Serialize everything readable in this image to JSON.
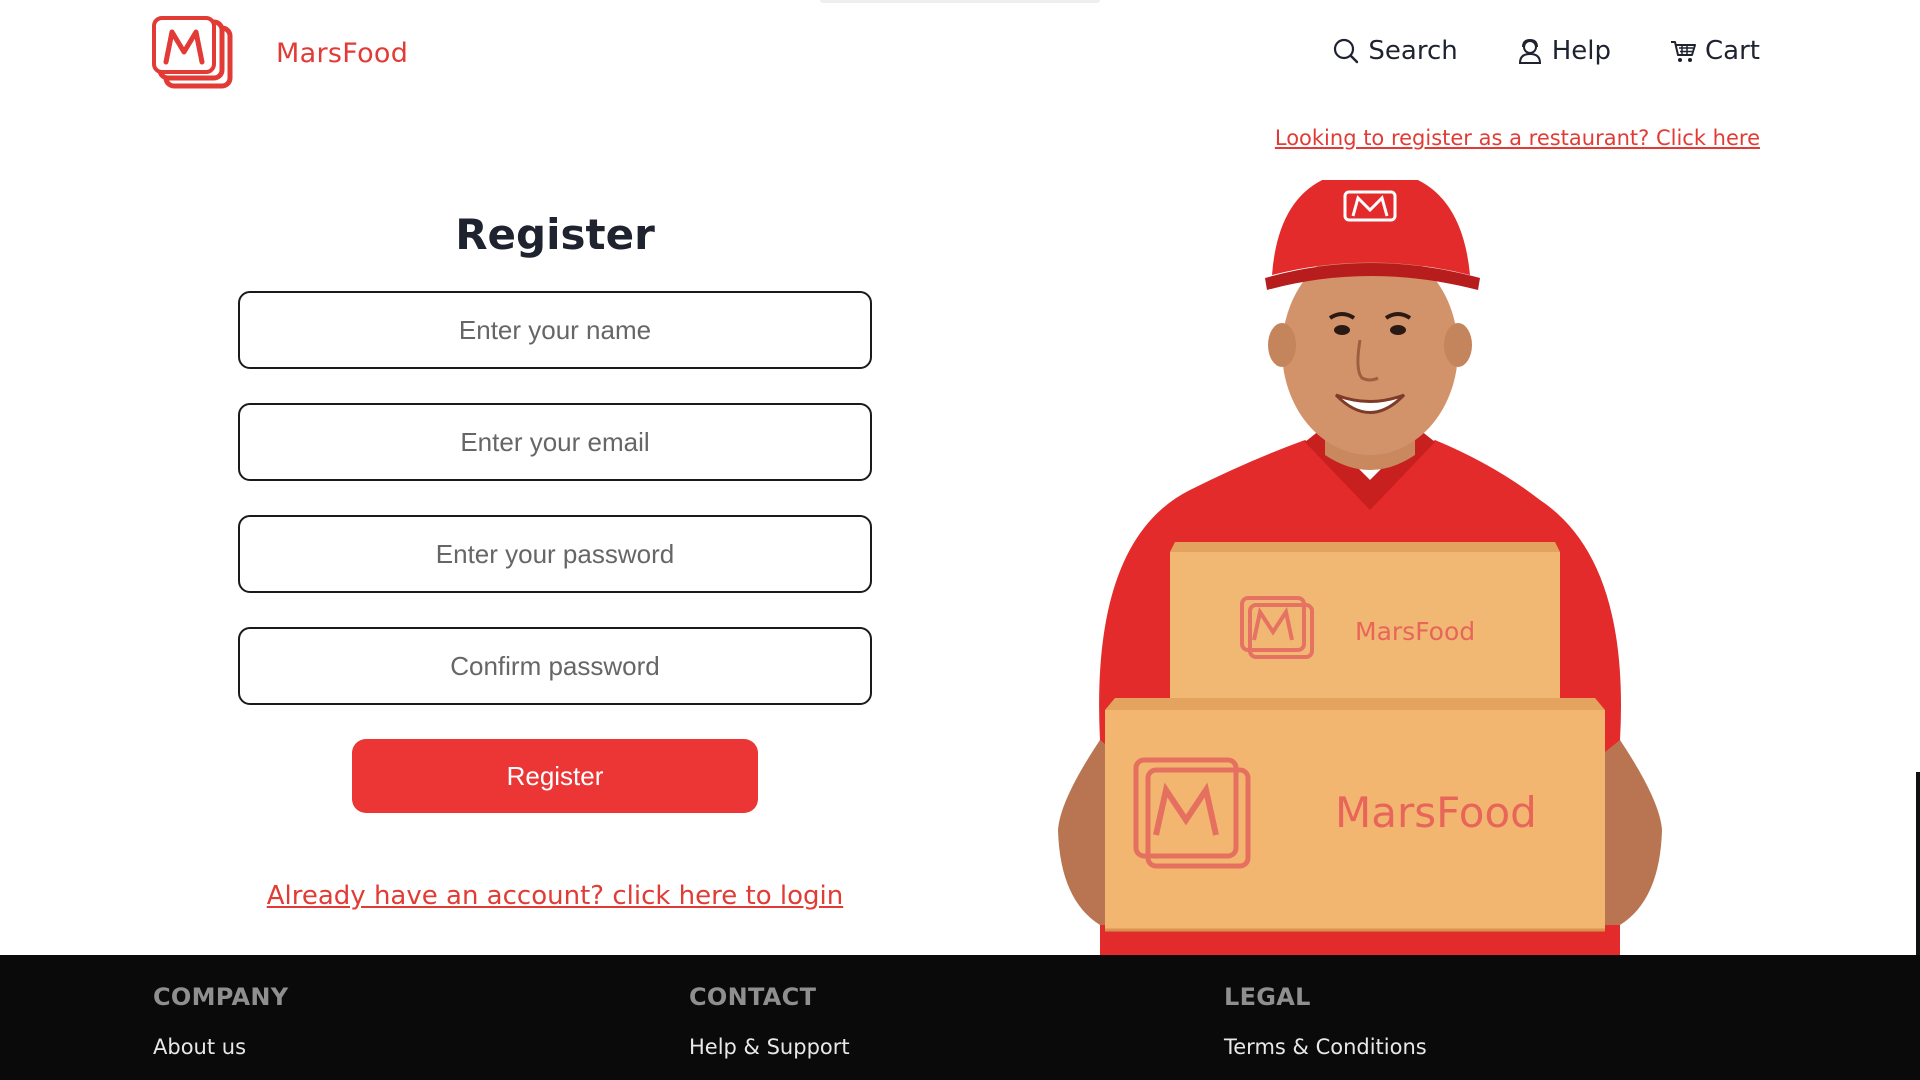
{
  "brand": {
    "name": "MarsFood",
    "color": "#e23b35"
  },
  "nav": {
    "items": [
      {
        "label": "Search",
        "icon": "search-icon"
      },
      {
        "label": "Help",
        "icon": "user-help-icon"
      },
      {
        "label": "Cart",
        "icon": "cart-icon"
      }
    ]
  },
  "restaurant_link": "Looking to register as a restaurant? Click here",
  "form": {
    "title": "Register",
    "name_placeholder": "Enter your name",
    "email_placeholder": "Enter your email",
    "password_placeholder": "Enter your password",
    "confirm_placeholder": "Confirm password",
    "submit_label": "Register",
    "login_link": "Already have an account? click here to login"
  },
  "hero": {
    "box_small_label": "MarsFood",
    "box_large_label": "MarsFood"
  },
  "footer": {
    "columns": [
      {
        "heading": "COMPANY",
        "link": "About us"
      },
      {
        "heading": "CONTACT",
        "link": "Help & Support"
      },
      {
        "heading": "LEGAL",
        "link": "Terms & Conditions"
      }
    ]
  },
  "colors": {
    "accent": "#ec3535",
    "footer_bg": "#0a0a0a",
    "box": "#f0b772"
  }
}
